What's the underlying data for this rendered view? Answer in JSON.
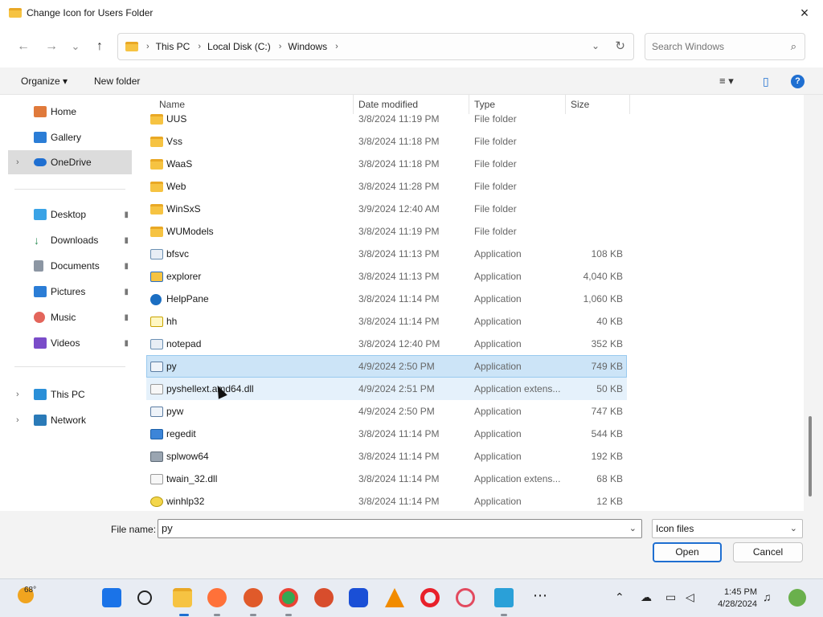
{
  "window": {
    "title": "Change Icon for Users Folder",
    "close_icon": "×"
  },
  "nav": {
    "back": "←",
    "forward": "→",
    "recent": "⌄",
    "up": "↑"
  },
  "address": {
    "crumbs": [
      "This PC",
      "Local Disk (C:)",
      "Windows"
    ],
    "separator": "›",
    "dropdown": "⌄",
    "refresh": "↻"
  },
  "search": {
    "placeholder": "Search Windows",
    "icon": "⌕"
  },
  "toolbar": {
    "organize": "Organize ▾",
    "new_folder": "New folder",
    "view": "≡ ▾",
    "pane": "▯",
    "help": "?"
  },
  "sidebar": {
    "items": [
      {
        "label": "Home",
        "icon": "home-icon",
        "color": "#e07a3b"
      },
      {
        "label": "Gallery",
        "icon": "gallery-icon",
        "color": "#2b7dd6"
      },
      {
        "label": "OneDrive",
        "icon": "onedrive-icon",
        "color": "#1f6fd1",
        "chevron": "›"
      },
      {
        "label": "Desktop",
        "icon": "desktop-icon",
        "color": "#3aa3e6",
        "pin": "📌"
      },
      {
        "label": "Downloads",
        "icon": "downloads-icon",
        "color": "#2f8f58",
        "pin": "📌"
      },
      {
        "label": "Documents",
        "icon": "documents-icon",
        "color": "#8c96a3",
        "pin": "📌"
      },
      {
        "label": "Pictures",
        "icon": "pictures-icon",
        "color": "#2b7dd6",
        "pin": "📌"
      },
      {
        "label": "Music",
        "icon": "music-icon",
        "color": "#e3655b",
        "pin": "📌"
      },
      {
        "label": "Videos",
        "icon": "videos-icon",
        "color": "#7a4cc9",
        "pin": "📌"
      },
      {
        "label": "This PC",
        "icon": "computer-icon",
        "color": "#2a8fd8",
        "chevron": "›"
      },
      {
        "label": "Network",
        "icon": "network-icon",
        "color": "#2a7ab8",
        "chevron": "›"
      }
    ]
  },
  "columns": {
    "name": "Name",
    "date": "Date modified",
    "type": "Type",
    "size": "Size",
    "sort": "⌃"
  },
  "files": [
    {
      "name": "UUS",
      "date": "3/8/2024 11:19 PM",
      "type": "File folder",
      "size": "",
      "icon": "folder"
    },
    {
      "name": "Vss",
      "date": "3/8/2024 11:18 PM",
      "type": "File folder",
      "size": "",
      "icon": "folder"
    },
    {
      "name": "WaaS",
      "date": "3/8/2024 11:18 PM",
      "type": "File folder",
      "size": "",
      "icon": "folder"
    },
    {
      "name": "Web",
      "date": "3/8/2024 11:28 PM",
      "type": "File folder",
      "size": "",
      "icon": "folder"
    },
    {
      "name": "WinSxS",
      "date": "3/9/2024 12:40 AM",
      "type": "File folder",
      "size": "",
      "icon": "folder"
    },
    {
      "name": "WUModels",
      "date": "3/8/2024 11:19 PM",
      "type": "File folder",
      "size": "",
      "icon": "folder"
    },
    {
      "name": "bfsvc",
      "date": "3/8/2024 11:13 PM",
      "type": "Application",
      "size": "108 KB",
      "icon": "app"
    },
    {
      "name": "explorer",
      "date": "3/8/2024 11:13 PM",
      "type": "Application",
      "size": "4,040 KB",
      "icon": "explorer"
    },
    {
      "name": "HelpPane",
      "date": "3/8/2024 11:14 PM",
      "type": "Application",
      "size": "1,060 KB",
      "icon": "help"
    },
    {
      "name": "hh",
      "date": "3/8/2024 11:14 PM",
      "type": "Application",
      "size": "40 KB",
      "icon": "hh"
    },
    {
      "name": "notepad",
      "date": "3/8/2024 12:40 PM",
      "type": "Application",
      "size": "352 KB",
      "icon": "app"
    },
    {
      "name": "py",
      "date": "4/9/2024 2:50 PM",
      "type": "Application",
      "size": "749 KB",
      "icon": "py",
      "state": "selected"
    },
    {
      "name": "pyshellext.amd64.dll",
      "date": "4/9/2024 2:51 PM",
      "type": "Application extens...",
      "size": "50 KB",
      "icon": "dll",
      "state": "hover"
    },
    {
      "name": "pyw",
      "date": "4/9/2024 2:50 PM",
      "type": "Application",
      "size": "747 KB",
      "icon": "py"
    },
    {
      "name": "regedit",
      "date": "3/8/2024 11:14 PM",
      "type": "Application",
      "size": "544 KB",
      "icon": "reg"
    },
    {
      "name": "splwow64",
      "date": "3/8/2024 11:14 PM",
      "type": "Application",
      "size": "192 KB",
      "icon": "spl"
    },
    {
      "name": "twain_32.dll",
      "date": "3/8/2024 11:14 PM",
      "type": "Application extens...",
      "size": "68 KB",
      "icon": "dll"
    },
    {
      "name": "winhlp32",
      "date": "3/8/2024 11:14 PM",
      "type": "Application",
      "size": "12 KB",
      "icon": "winh"
    }
  ],
  "footer": {
    "filename_label": "File name:",
    "filename_value": "py",
    "filetype": "Icon files",
    "dropdown": "⌄",
    "open": "Open",
    "cancel": "Cancel"
  },
  "taskbar": {
    "temperature": "68°",
    "time": "1:45 PM",
    "date": "4/28/2024",
    "apps": [
      {
        "name": "start-icon",
        "color": "#1a73e8"
      },
      {
        "name": "search-icon",
        "color": "#222222"
      },
      {
        "name": "file-explorer-icon",
        "color": "#f6c342"
      },
      {
        "name": "firefox-icon",
        "color": "#ff7139"
      },
      {
        "name": "app-icon",
        "color": "#e05a2a"
      },
      {
        "name": "chrome-icon",
        "color": "#34a853"
      },
      {
        "name": "app-icon",
        "color": "#d84d2c"
      },
      {
        "name": "malwarebytes-icon",
        "color": "#1a4fd6"
      },
      {
        "name": "vlc-icon",
        "color": "#f18b00"
      },
      {
        "name": "opera-icon",
        "color": "#e8202a"
      },
      {
        "name": "opera-gx-icon",
        "color": "#e24a5f"
      },
      {
        "name": "app-icon",
        "color": "#2aa0d8"
      },
      {
        "name": "more-icon",
        "color": "#333333"
      }
    ]
  }
}
